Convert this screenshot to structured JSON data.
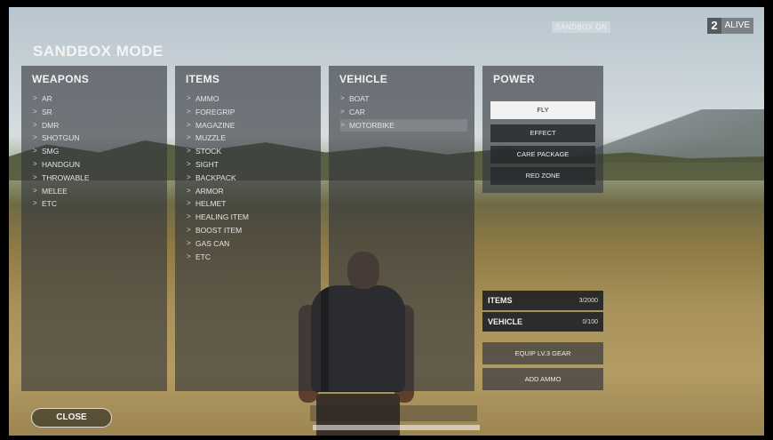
{
  "mode_title": "SANDBOX MODE",
  "sandbox_tag": "SANDBOX ON",
  "alive": {
    "count": "2",
    "label": "ALIVE"
  },
  "weapons": {
    "heading": "WEAPONS",
    "items": [
      "AR",
      "SR",
      "DMR",
      "SHOTGUN",
      "SMG",
      "HANDGUN",
      "THROWABLE",
      "MELEE",
      "ETC"
    ]
  },
  "items": {
    "heading": "ITEMS",
    "items": [
      "AMMO",
      "FOREGRIP",
      "MAGAZINE",
      "MUZZLE",
      "STOCK",
      "SIGHT",
      "BACKPACK",
      "ARMOR",
      "HELMET",
      "HEALING ITEM",
      "BOOST ITEM",
      "GAS CAN",
      "ETC"
    ]
  },
  "vehicle": {
    "heading": "VEHICLE",
    "items": [
      "BOAT",
      "CAR",
      "MOTORBIKE"
    ],
    "selected_index": 2
  },
  "power": {
    "heading": "POWER",
    "buttons": [
      "FLY",
      "EFFECT",
      "CARE PACKAGE",
      "RED ZONE"
    ],
    "active_index": 0
  },
  "counters": [
    {
      "label": "ITEMS",
      "value": "3/2000"
    },
    {
      "label": "VEHICLE",
      "value": "0/100"
    }
  ],
  "actions": [
    "EQUIP LV.3 GEAR",
    "ADD AMMO"
  ],
  "close_label": "CLOSE",
  "chevron_glyph": ">",
  "colors": {
    "active_button": "#f1f1f1",
    "panel_bg": "#32363c"
  }
}
